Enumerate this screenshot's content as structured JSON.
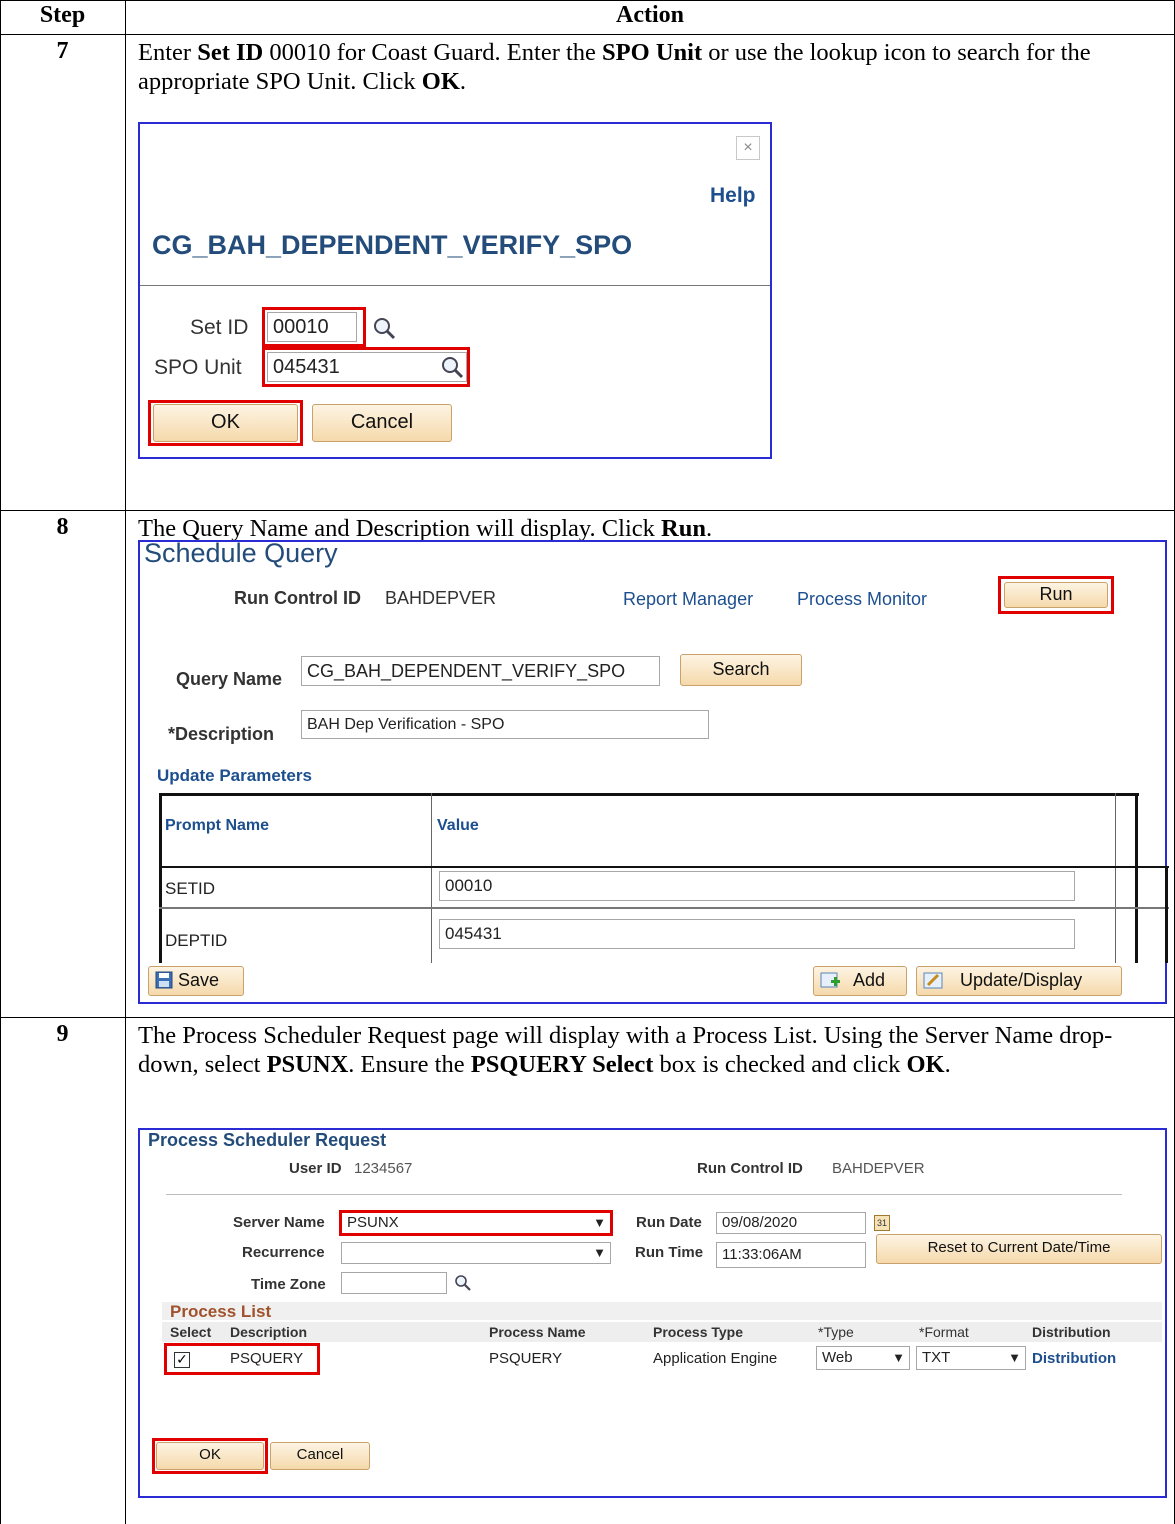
{
  "table": {
    "header_step": "Step",
    "header_action": "Action"
  },
  "steps": [
    {
      "number": "7",
      "text_parts": [
        "Enter ",
        "Set ID",
        " 00010 for Coast Guard. Enter the ",
        "SPO Unit",
        " or use the lookup icon to search for the appropriate SPO Unit. Click ",
        "OK",
        "."
      ],
      "dialog": {
        "help_link": "Help",
        "title": "CG_BAH_DEPENDENT_VERIFY_SPO",
        "setid_label": "Set ID",
        "setid_value": "00010",
        "spo_label": "SPO Unit",
        "spo_value": "045431",
        "ok_label": "OK",
        "cancel_label": "Cancel"
      }
    },
    {
      "number": "8",
      "text_parts": [
        "The Query Name and Description will display. Click ",
        "Run",
        "."
      ],
      "schedule": {
        "title": "Schedule Query",
        "run_control_label": "Run Control ID",
        "run_control_value": "BAHDEPVER",
        "report_manager": "Report Manager",
        "process_monitor": "Process Monitor",
        "run_label": "Run",
        "query_name_label": "Query Name",
        "query_name_value": "CG_BAH_DEPENDENT_VERIFY_SPO",
        "search_label": "Search",
        "description_label": "*Description",
        "description_value": "BAH Dep Verification - SPO",
        "update_params": "Update Parameters",
        "col_prompt": "Prompt Name",
        "col_value": "Value",
        "rows": [
          {
            "prompt": "SETID",
            "value": "00010"
          },
          {
            "prompt": "DEPTID",
            "value": "045431"
          }
        ],
        "save_label": "Save",
        "add_label": "Add",
        "update_display_label": "Update/Display"
      }
    },
    {
      "number": "9",
      "text_parts": [
        "The Process Scheduler Request page will display with a Process List. Using the Server Name drop-down, select ",
        "PSUNX",
        ". Ensure the ",
        "PSQUERY Select",
        " box is checked and click ",
        "OK",
        "."
      ],
      "scheduler": {
        "title": "Process Scheduler Request",
        "user_id_label": "User ID",
        "user_id_value": "1234567",
        "run_control_label": "Run Control ID",
        "run_control_value": "BAHDEPVER",
        "server_name_label": "Server Name",
        "server_name_value": "PSUNX",
        "run_date_label": "Run Date",
        "run_date_value": "09/08/2020",
        "recurrence_label": "Recurrence",
        "recurrence_value": "",
        "run_time_label": "Run Time",
        "run_time_value": "11:33:06AM",
        "reset_label": "Reset to Current Date/Time",
        "time_zone_label": "Time Zone",
        "time_zone_value": "",
        "process_list_title": "Process List",
        "columns": [
          "Select",
          "Description",
          "Process Name",
          "Process Type",
          "*Type",
          "*Format",
          "Distribution"
        ],
        "row": {
          "description": "PSQUERY",
          "process_name": "PSQUERY",
          "process_type": "Application Engine",
          "type": "Web",
          "format": "TXT",
          "distribution": "Distribution"
        },
        "ok_label": "OK",
        "cancel_label": "Cancel"
      }
    }
  ],
  "colors": {
    "highlight": "#e00000",
    "link": "#1d4f8f",
    "frame_blue": "#2b2bd6",
    "process_list_header": "#a0522d"
  }
}
